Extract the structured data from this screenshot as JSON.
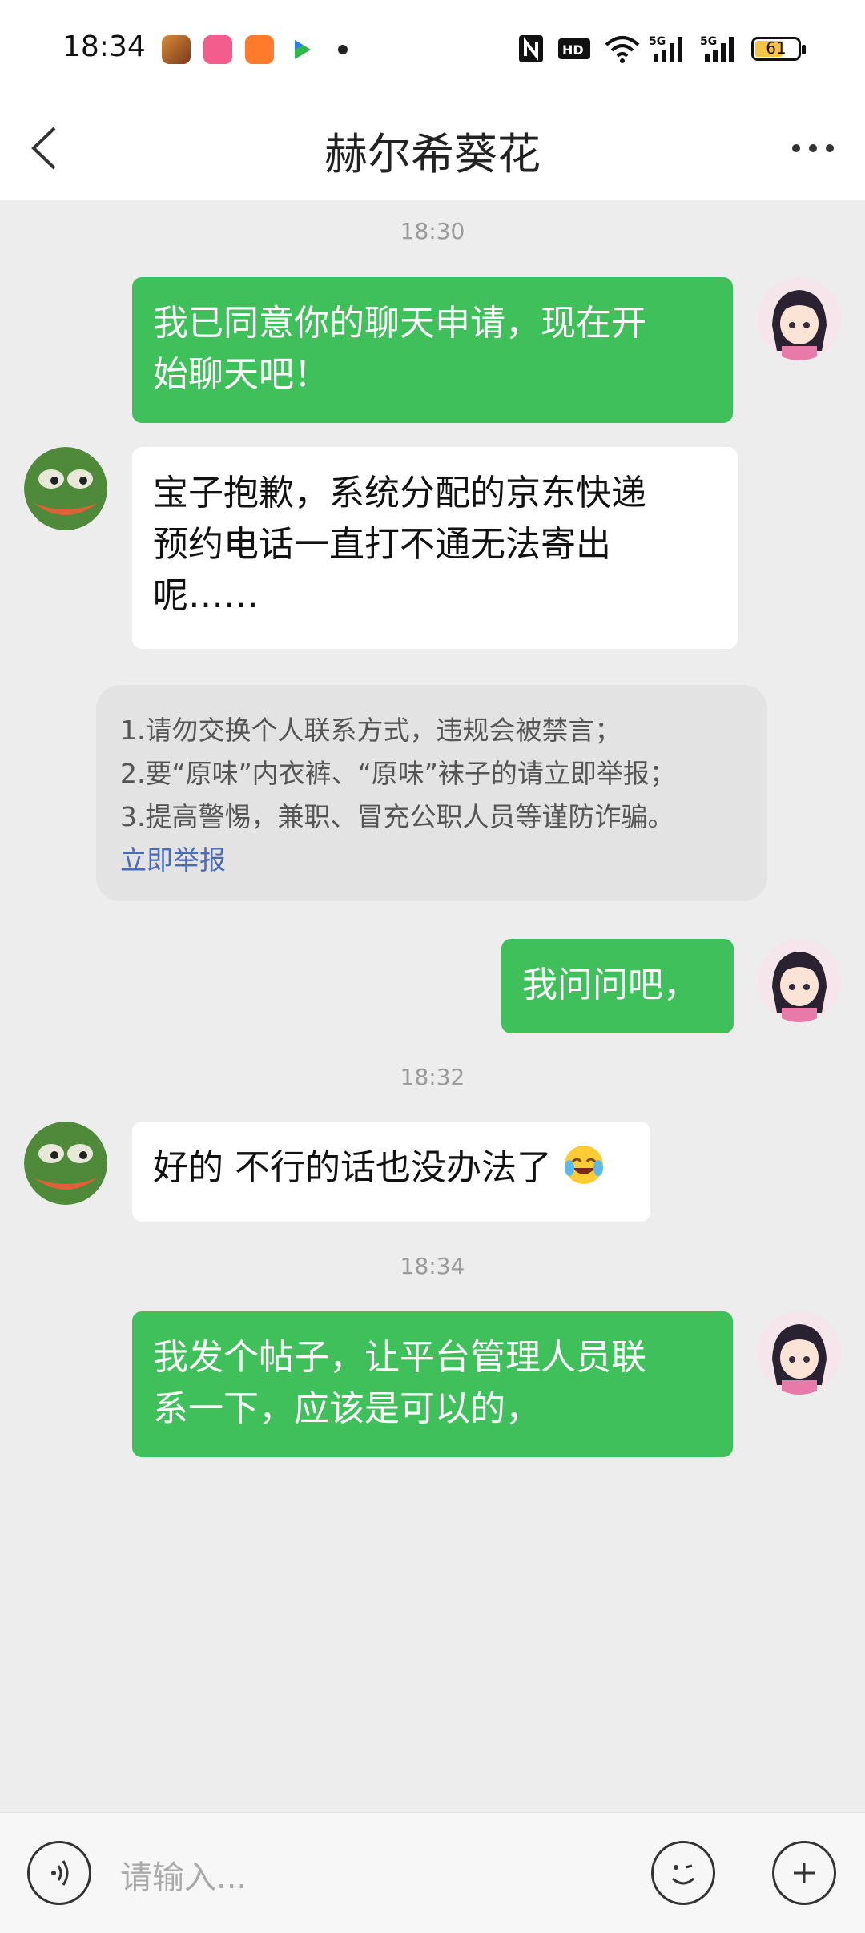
{
  "status_bar": {
    "time": "18:34",
    "battery": "61"
  },
  "header": {
    "title": "赫尔希葵花",
    "back_icon": "chevron-left-icon",
    "more_icon": "more-dots-icon"
  },
  "messages": {
    "ts1": "18:30",
    "m1": {
      "line1": "我已同意你的聊天申请，现在开",
      "line2": "始聊天吧！"
    },
    "m2": {
      "line1": "宝子抱歉，系统分配的京东快递",
      "line2": "预约电话一直打不通无法寄出",
      "line3": "呢……"
    },
    "notice": {
      "line1": "1.请勿交换个人联系方式，违规会被禁言；",
      "line2": "2.要“原味”内衣裤、“原味”袜子的请立即举报；",
      "line3": "3.提高警惕，兼职、冒充公职人员等谨防诈骗。",
      "link": "立即举报"
    },
    "m3": {
      "text": "我问问吧，"
    },
    "ts2": "18:32",
    "m4": {
      "text": "好的 不行的话也没办法了"
    },
    "ts3": "18:34",
    "m5": {
      "line1": "我发个帖子，让平台管理人员联",
      "line2": "系一下，应该是可以的，"
    }
  },
  "input_bar": {
    "placeholder": "请输入...",
    "voice_icon": "voice-icon",
    "emoji_icon": "emoji-icon",
    "plus_icon": "plus-icon"
  },
  "colors": {
    "outgoing_bubble": "#40c05a",
    "incoming_bubble": "#ffffff",
    "background": "#ededed",
    "link": "#4a6bb8"
  }
}
